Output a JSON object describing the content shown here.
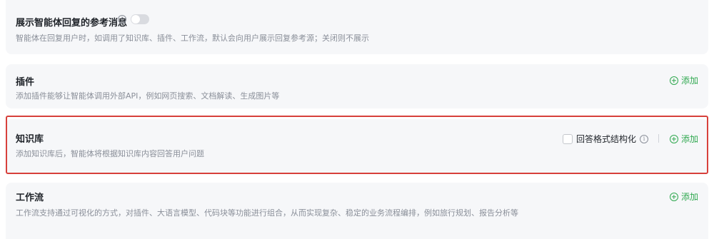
{
  "sections": {
    "reference": {
      "title": "展示智能体回复的参考消息",
      "description": "智能体在回复用户时，如调用了知识库、插件、工作流，默认会向用户展示回复参考源；关闭则不展示",
      "info_glyph": "i",
      "toggle_on": false
    },
    "plugins": {
      "title": "插件",
      "description": "添加插件能够让智能体调用外部API，例如网页搜索、文档解读、生成图片等",
      "add_label": "添加"
    },
    "knowledge": {
      "title": "知识库",
      "description": "添加知识库后，智能体将根据知识库内容回答用户问题",
      "structured_label": "回答格式结构化",
      "structured_checked": false,
      "info_glyph": "i",
      "add_label": "添加"
    },
    "workflow": {
      "title": "工作流",
      "description": "工作流支持通过可视化的方式，对插件、大语言模型、代码块等功能进行组合，从而实现复杂、稳定的业务流程编排，例如旅行规划、报告分析等",
      "add_label": "添加"
    }
  },
  "colors": {
    "accent": "#2fa84f",
    "highlight": "#d7403b",
    "card_bg": "#f6f7f9",
    "muted_text": "#8a8f99"
  },
  "icons": {
    "info": "info-icon",
    "add": "plus-circle-icon"
  }
}
